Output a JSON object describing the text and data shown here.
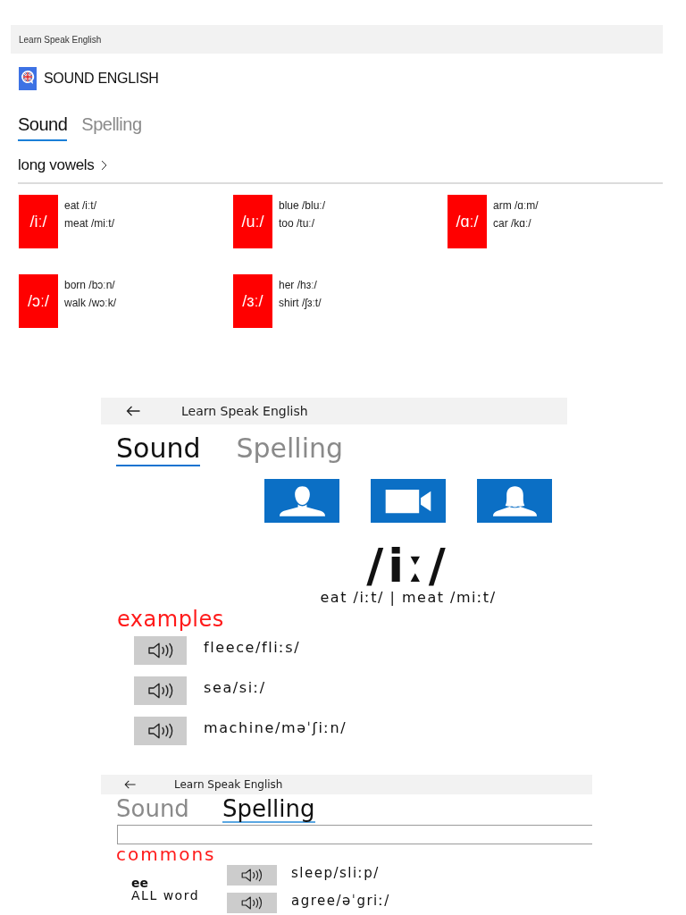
{
  "screens": [
    {
      "kind": "home",
      "title_bar": {
        "title": "Learn Speak English"
      },
      "app_name": "SOUND ENGLISH",
      "tabs": [
        {
          "label": "Sound",
          "selected": true
        },
        {
          "label": "Spelling",
          "selected": false
        }
      ],
      "category": "long vowels",
      "vowels": [
        {
          "symbol": "/iː/",
          "examples": [
            "eat /iːt/",
            "meat /miːt/"
          ]
        },
        {
          "symbol": "/uː/",
          "examples": [
            "blue /bluː/",
            "too /tuː/"
          ]
        },
        {
          "symbol": "/ɑː/",
          "examples": [
            "arm /ɑːm/",
            "car /kɑː/"
          ]
        },
        {
          "symbol": "/ɔː/",
          "examples": [
            "born /bɔːn/",
            "walk /wɔːk/"
          ]
        },
        {
          "symbol": "/ɜː/",
          "examples": [
            "her /hɜː/",
            "shirt /ʃɜːt/"
          ]
        }
      ]
    },
    {
      "kind": "sound",
      "title_bar": {
        "title": "Learn Speak English",
        "back": true
      },
      "tabs": [
        {
          "label": "Sound",
          "selected": true
        },
        {
          "label": "Spelling",
          "selected": false
        }
      ],
      "media_buttons": [
        {
          "kind": "male"
        },
        {
          "kind": "video"
        },
        {
          "kind": "female"
        }
      ],
      "symbol": "/iː/",
      "example_line": "eat /iːt/ | meat /miːt/",
      "examples_heading": "examples",
      "examples": [
        "fleece/fliːs/",
        "sea/siː/",
        "machine/məˈʃiːn/"
      ]
    },
    {
      "kind": "spelling",
      "title_bar": {
        "title": "Learn Speak English",
        "back": true
      },
      "tabs": [
        {
          "label": "Sound",
          "selected": false
        },
        {
          "label": "Spelling",
          "selected": true
        }
      ],
      "heading": "commons",
      "groups": [
        {
          "pattern": "ee",
          "note": "ALL word",
          "words": [
            "sleep/sliːp/",
            "agree/əˈgriː/"
          ]
        }
      ]
    }
  ]
}
